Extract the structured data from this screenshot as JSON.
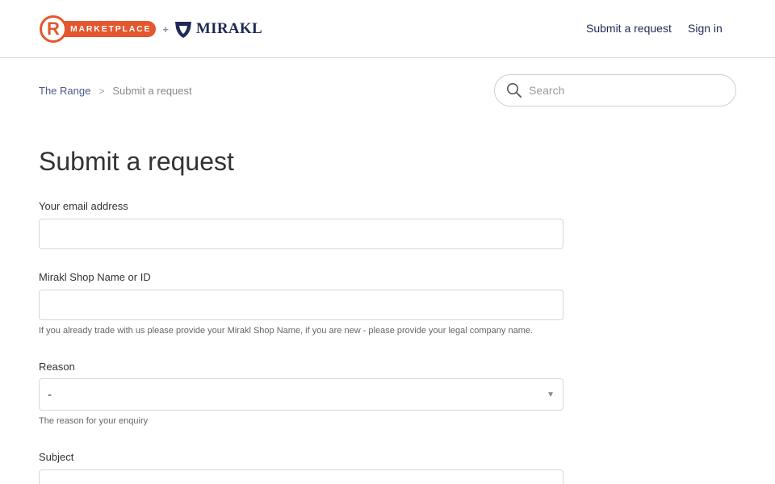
{
  "header": {
    "logo": {
      "r_letter": "R",
      "marketplace_text": "MARKETPLACE",
      "plus": "+",
      "mirakl_text": "MIRAKL"
    },
    "nav": {
      "submit_request": "Submit a request",
      "sign_in": "Sign in"
    }
  },
  "breadcrumb": {
    "home": "The Range",
    "separator": ">",
    "current": "Submit a request"
  },
  "search": {
    "placeholder": "Search",
    "value": ""
  },
  "form": {
    "title": "Submit a request",
    "email": {
      "label": "Your email address",
      "value": ""
    },
    "shop": {
      "label": "Mirakl Shop Name or ID",
      "value": "",
      "hint": "If you already trade with us please provide your Mirakl Shop Name, if you are new - please provide your legal company name."
    },
    "reason": {
      "label": "Reason",
      "selected": "-",
      "hint": "The reason for your enquiry"
    },
    "subject": {
      "label": "Subject",
      "value": ""
    }
  },
  "colors": {
    "brand_orange": "#e4572e",
    "brand_navy": "#1e2a55",
    "link": "#4b5a8a"
  },
  "icons": {
    "search": "search-icon",
    "mirakl_shield": "mirakl-shield-icon",
    "dropdown": "chevron-down-icon"
  }
}
